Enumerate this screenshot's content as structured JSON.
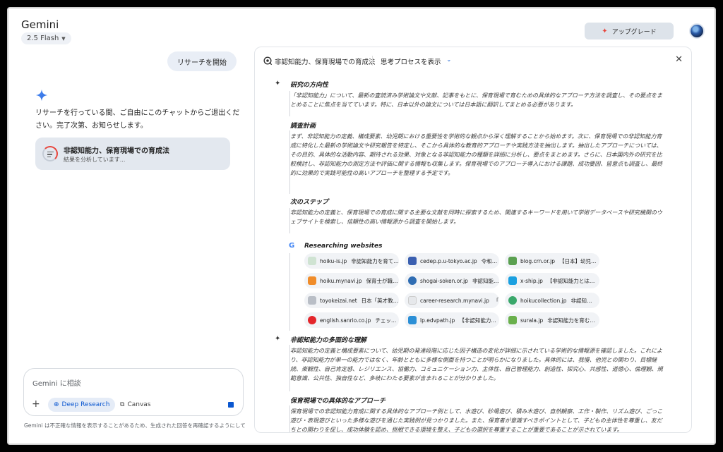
{
  "app": {
    "title": "Gemini",
    "model": "2.5 Flash",
    "upgrade_label": "アップグレード"
  },
  "chat": {
    "user_message": "リサーチを開始",
    "assistant_message": "リサーチを行っている間、ご自由にこのチャットからご退出ください。完了次第、お知らせします。",
    "research_card": {
      "title": "非認知能力、保育現場での育成法",
      "status": "結果を分析しています..."
    }
  },
  "input": {
    "placeholder": "Gemini に相談",
    "deep_research_label": "Deep Research",
    "canvas_label": "Canvas",
    "disclaimer": "Gemini は不正確な情報を表示することがあるため、生成された回答を再確認するようにして"
  },
  "panel": {
    "title": "非認知能力、保育現場での育成法",
    "think_label": "思考プロセスを表示",
    "sections": [
      {
        "title": "研究の方向性",
        "text": "「非認知能力」について、最新の査読済み学術論文や文献、記事をもとに、保育現場で育むための具体的なアプローチ方法を調査し、その要点をまとめることに焦点を当てています。特に、日本以外の論文については日本語に翻訳してまとめる必要があります。"
      },
      {
        "title": "調査計画",
        "text": "まず、非認知能力の定義、構成要素、幼児期における重要性を学術的な観点から深く理解することから始めます。次に、保育現場での非認知能力育成に特化した最新の学術論文や研究報告を特定し、そこから具体的な教育的アプローチや実践方法を抽出します。抽出したアプローチについては、その目的、具体的な活動内容、期待される効果、対象となる非認知能力の種類を詳細に分析し、要点をまとめます。さらに、日本国内外の研究を比較検討し、非認知能力の測定方法や評価に関する情報も収集します。保育現場でのアプローチ導入における課題、成功要因、留意点も調査し、最終的に効果的で実践可能性の高いアプローチを整理する予定です。"
      },
      {
        "title": "次のステップ",
        "text": "非認知能力の定義と、保育現場での育成に関する主要な文献を同時に探索するため、関連するキーワードを用いて学術データベースや研究機関のウェブサイトを検索し、信頼性の高い情報源から調査を開始します。"
      }
    ],
    "sites_title": "Researching websites",
    "sites": [
      {
        "domain": "hoiku-is.jp",
        "title": "非認知能力を育てる…",
        "color": "#cfe3d2"
      },
      {
        "domain": "cedep.p.u-tokyo.ac.jp",
        "title": "令和3年度文部…",
        "color": "#3a5fb0"
      },
      {
        "domain": "blog.crn.or.jp",
        "title": "【日本】幼児…",
        "color": "#5aa050"
      },
      {
        "domain": "hoiku.mynavi.jp",
        "title": "保育士が職…",
        "color": "#f08c2a"
      },
      {
        "domain": "shogai-soken.or.jp",
        "title": "非認知能力につ…",
        "color": "#2f6db3"
      },
      {
        "domain": "x-ship.jp",
        "title": "【非認知能力とは？…",
        "color": "#1aa0e0"
      },
      {
        "domain": "toyokeizai.net",
        "title": "日本「英才教…",
        "color": "#b9bec6"
      },
      {
        "domain": "career-research.mynavi.jp",
        "title": "「仕事…",
        "color": "#e6e8eb"
      },
      {
        "domain": "hoikucollection.jp",
        "title": "非認知…",
        "color": "#3aa86b"
      },
      {
        "domain": "english.sanrio.co.jp",
        "title": "チェッ…",
        "color": "#e4262b"
      },
      {
        "domain": "lp.edvpath.jp",
        "title": "【非認知能力…",
        "color": "#2b8fd6"
      },
      {
        "domain": "surala.jp",
        "title": "非認知能力を育む…",
        "color": "#6ab04c"
      }
    ],
    "sections2": [
      {
        "title": "非認知能力の多面的な理解",
        "text": "非認知能力の定義と構成要素について、幼児期の発達段階に応じた因子構造の変化が詳細に示されている学術的な情報源を確認しました。これにより、非認知能力が単一の能力ではなく、年齢とともに多様な側面を持つことが明らかになりました。具体的には、我慢、他児との関わり、目標継続、楽観性、自己肯定感、レジリエンス、協働力、コミュニケーション力、主体性、自己管理能力、創造性、探究心、共感性、道徳心、倫理観、規範意識、公共性、独自性など、多岐にわたる要素が含まれることが分かりました。"
      },
      {
        "title": "保育現場での具体的なアプローチ",
        "text": "保育現場での非認知能力育成に関する具体的なアプローチ例として、水遊び、砂場遊び、積み木遊び、自然観察、工作・製作、リズム遊び、ごっこ遊び・表現遊びといった多様な遊びを通じた実践例が見つかりました。また、保育者が意識すべきポイントとして、子どもの主体性を尊重し、友だちとの関わりを促し、成功体験を認め、挑戦できる環境を整え、子どもの選択を尊重することが重要であることが示されています。"
      }
    ]
  }
}
